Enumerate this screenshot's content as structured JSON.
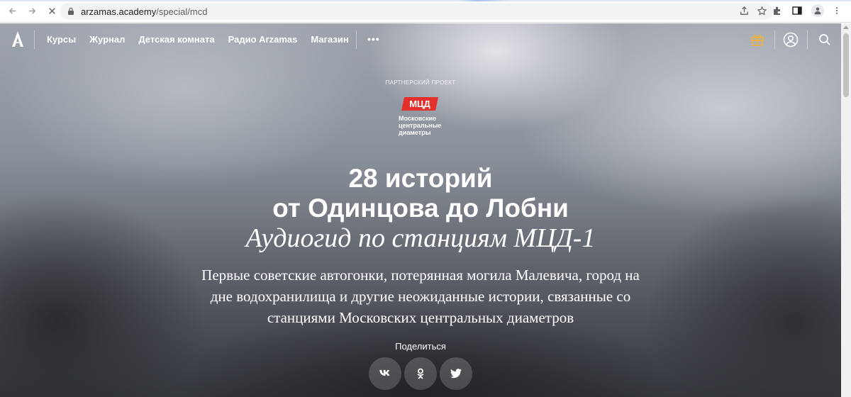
{
  "browser": {
    "url_host": "arzamas.academy",
    "url_path": "/special/mcd"
  },
  "header": {
    "nav": [
      "Курсы",
      "Журнал",
      "Детская комната",
      "Радио Arzamas",
      "Магазин"
    ],
    "more": "•••",
    "gift_color": "#f2b233"
  },
  "hero": {
    "partner_label": "ПАРТНЕРСКИЙ ПРОЕКТ",
    "mcd_badge": "МЦД",
    "mcd_name_lines": [
      "Московские",
      "центральные",
      "диаметры"
    ],
    "mcd_color": "#e4302b",
    "title_line1": "28 историй",
    "title_line2": "от Одинцова до Лобни",
    "subtitle": "Аудиогид по станциям МЦД-1",
    "description": "Первые советские автогонки, потерянная могила Малевича, город на дне водохранилища и другие неожиданные истории, связанные со станциями Московских центральных диаметров",
    "share_label": "Поделиться",
    "share_buttons": [
      "vk",
      "ok",
      "twitter"
    ]
  }
}
